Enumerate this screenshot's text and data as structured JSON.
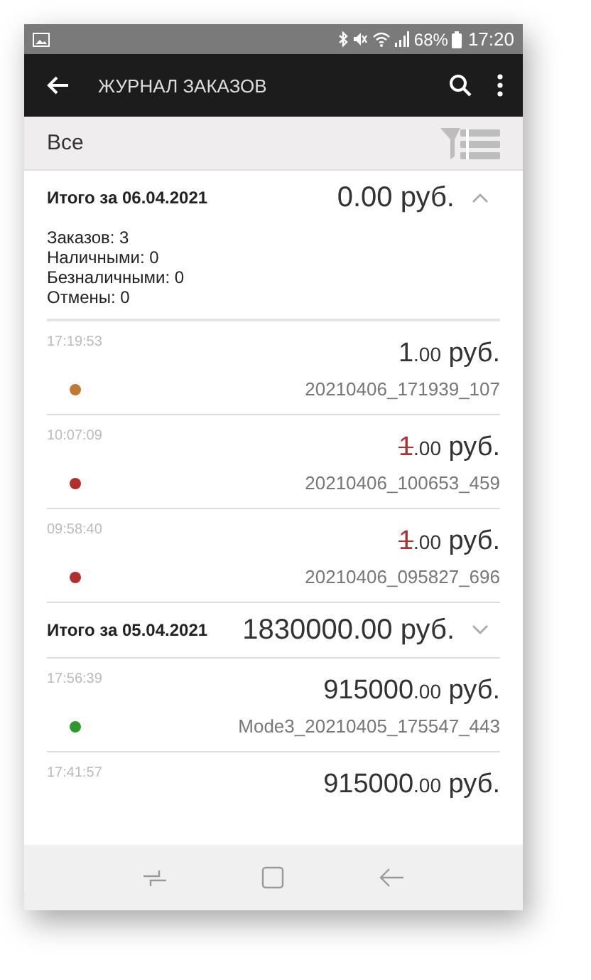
{
  "status_bar": {
    "battery": "68%",
    "time": "17:20"
  },
  "app_bar": {
    "title": "ЖУРНАЛ ЗАКАЗОВ"
  },
  "filter": {
    "label": "Все"
  },
  "groups": [
    {
      "title": "Итого за 06.04.2021",
      "total": "0.00 руб.",
      "expanded": true,
      "stats": [
        "Заказов: 3",
        "Наличными: 0",
        "Безналичными: 0",
        "Отмены: 0"
      ],
      "orders": [
        {
          "time": "17:19:53",
          "integer": "1",
          "fraction": ".00",
          "currency": "руб.",
          "cancelled": false,
          "color": "#c07a35",
          "id": "20210406_171939_107"
        },
        {
          "time": "10:07:09",
          "integer": "1",
          "fraction": ".00",
          "currency": "руб.",
          "cancelled": true,
          "color": "#b03030",
          "id": "20210406_100653_459"
        },
        {
          "time": "09:58:40",
          "integer": "1",
          "fraction": ".00",
          "currency": "руб.",
          "cancelled": true,
          "color": "#b03030",
          "id": "20210406_095827_696"
        }
      ]
    },
    {
      "title": "Итого за 05.04.2021",
      "total": "1830000.00 руб.",
      "expanded": false,
      "orders": [
        {
          "time": "17:56:39",
          "integer": "915000",
          "fraction": ".00",
          "currency": "руб.",
          "cancelled": false,
          "color": "#2e9a2e",
          "id": "Mode3_20210405_175547_443"
        },
        {
          "time": "17:41:57",
          "integer": "915000",
          "fraction": ".00",
          "currency": "руб.",
          "cancelled": false
        }
      ]
    }
  ]
}
